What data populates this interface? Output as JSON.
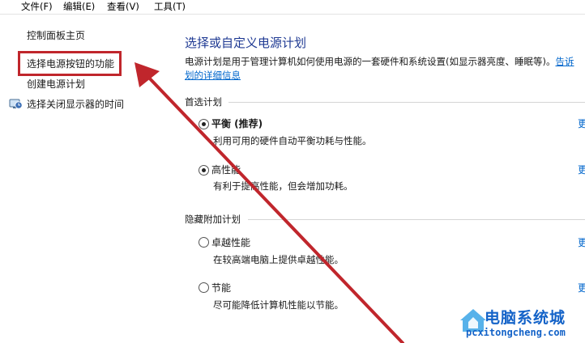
{
  "menu": {
    "file": "文件(F)",
    "edit": "编辑(E)",
    "view": "查看(V)",
    "tools": "工具(T)"
  },
  "sidebar": {
    "items": [
      {
        "label": "控制面板主页"
      },
      {
        "label": "选择电源按钮的功能"
      },
      {
        "label": "创建电源计划"
      },
      {
        "label": "选择关闭显示器的时间"
      }
    ]
  },
  "main": {
    "title": "选择或自定义电源计划",
    "description_line1": "电源计划是用于管理计算机如何使用电源的一套硬件和系统设置(如显示器亮度、睡眠等)。",
    "description_link_part1": "告诉",
    "description_link_part2": "划的详细信息",
    "preferred_group": "首选计划",
    "hidden_group": "隐藏附加计划",
    "more_label": "更改计划设置",
    "plans": [
      {
        "name": "平衡 (推荐)",
        "description": "利用可用的硬件自动平衡功耗与性能。",
        "selected": true
      },
      {
        "name": "高性能",
        "description": "有利于提高性能，但会增加功耗。",
        "selected": true
      },
      {
        "name": "卓越性能",
        "description": "在较高端电脑上提供卓越性能。",
        "selected": false
      },
      {
        "name": "节能",
        "description": "尽可能降低计算机性能以节能。",
        "selected": false
      }
    ]
  },
  "annotation": {
    "color": "#c0262c"
  },
  "watermark": {
    "title": "电脑系统城",
    "domain": "pcxitongcheng.com"
  },
  "colors": {
    "title": "#1f3a93",
    "link": "#0066cc",
    "watermark": "#1463c8"
  }
}
